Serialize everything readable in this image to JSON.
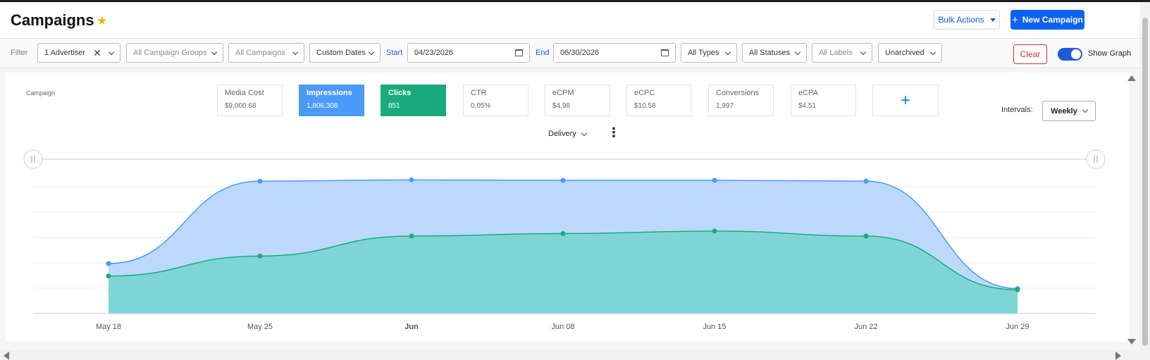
{
  "header": {
    "title": "Campaigns",
    "bulk_actions_label": "Bulk Actions",
    "new_campaign_label": "New Campaign"
  },
  "filters": {
    "label": "Filter",
    "advertiser": "1 Advertiser",
    "campaign_groups_placeholder": "All Campaign Groups",
    "campaigns_placeholder": "All Campaigns",
    "date_mode": "Custom Dates",
    "start_label": "Start",
    "start_date": "04/23/2026",
    "end_label": "End",
    "end_date": "06/30/2026",
    "types": "All Types",
    "statuses": "All Statuses",
    "labels_placeholder": "All Labels",
    "archive": "Unarchived",
    "clear_label": "Clear",
    "show_graph_label": "Show Graph",
    "show_graph_on": true
  },
  "graph": {
    "campaign_label": "Campaign",
    "metrics": [
      {
        "name": "Media Cost",
        "value": "$9,000.68"
      },
      {
        "name": "Impressions",
        "value": "1,806,308"
      },
      {
        "name": "Clicks",
        "value": "851"
      },
      {
        "name": "CTR",
        "value": "0.05%"
      },
      {
        "name": "eCPM",
        "value": "$4.98"
      },
      {
        "name": "eCPC",
        "value": "$10.58"
      },
      {
        "name": "Conversions",
        "value": "1,997"
      },
      {
        "name": "eCPA",
        "value": "$4.51"
      }
    ],
    "add_metric": "+",
    "intervals_label": "Intervals:",
    "interval": "Weekly",
    "delivery_label": "Delivery"
  },
  "chart_data": {
    "type": "area",
    "x": [
      "May 18",
      "May 25",
      "Jun",
      "Jun 08",
      "Jun 15",
      "Jun 22",
      "Jun 29"
    ],
    "series": [
      {
        "name": "Impressions",
        "color": "#4a9af8",
        "values": [
          0.2,
          0.53,
          0.535,
          0.533,
          0.533,
          0.53,
          0.1
        ]
      },
      {
        "name": "Clicks",
        "color": "#1aab7c",
        "values": [
          0.15,
          0.23,
          0.31,
          0.32,
          0.33,
          0.31,
          0.095
        ]
      }
    ],
    "ylim": [
      0,
      0.55
    ],
    "grid": true,
    "legend": "none"
  }
}
